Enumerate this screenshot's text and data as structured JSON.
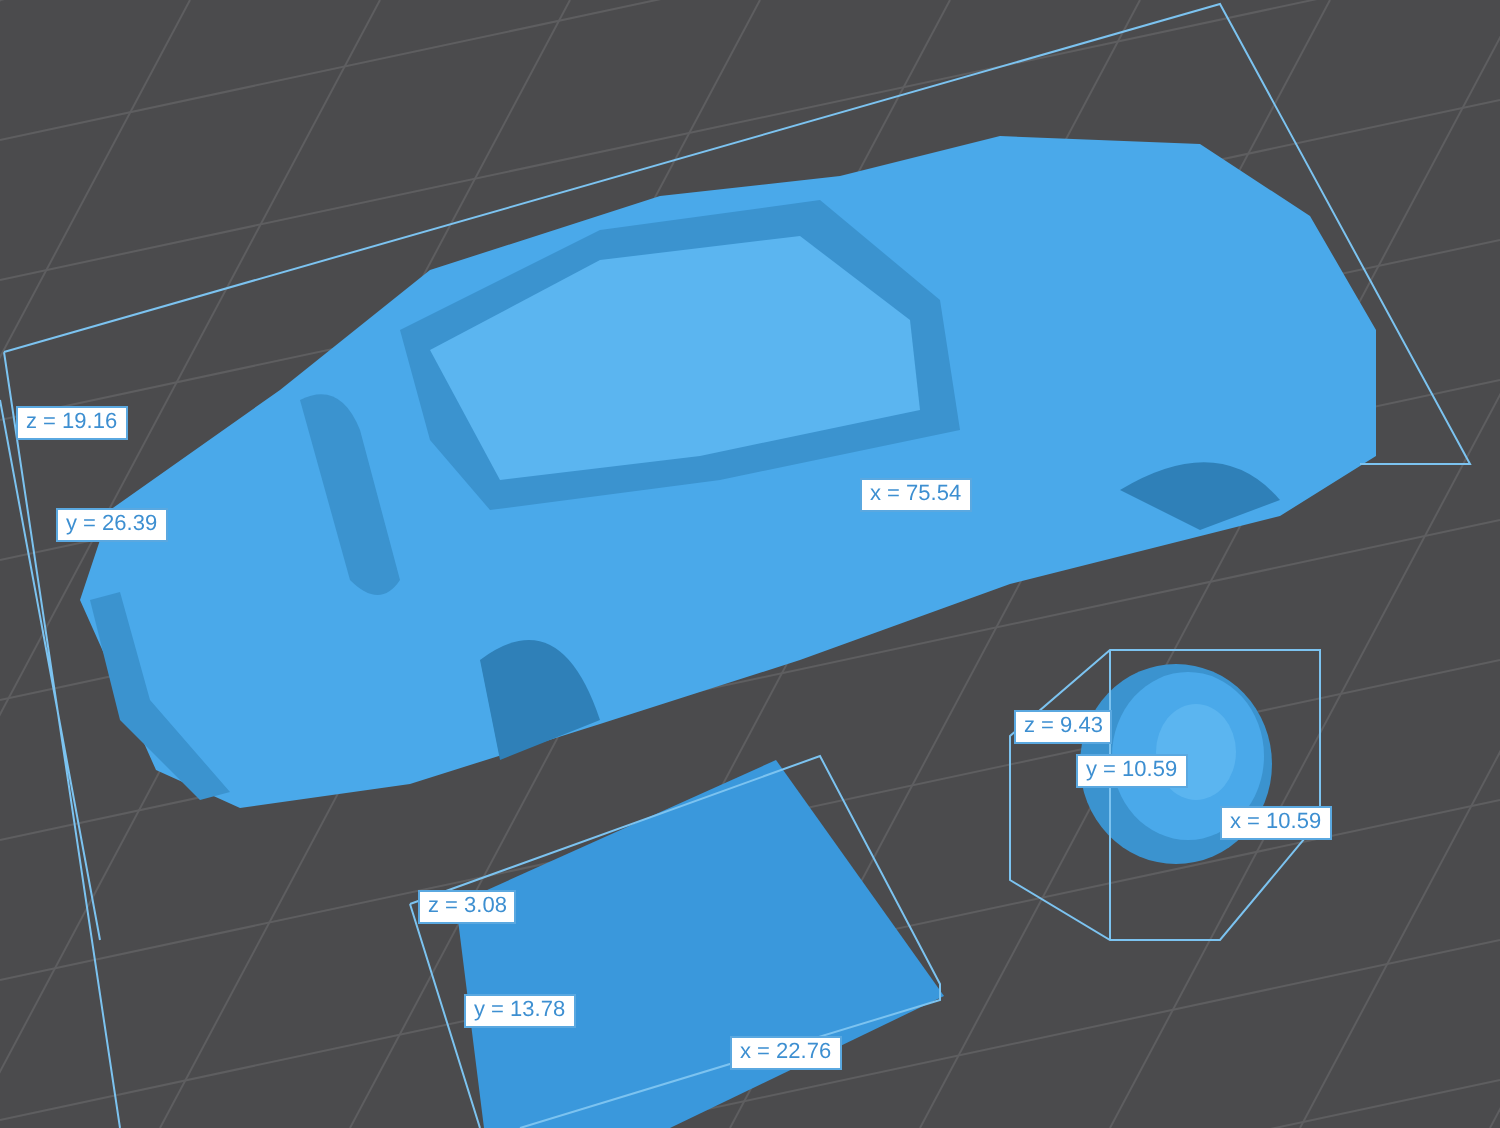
{
  "viewport": {
    "objects": [
      {
        "kind": "car",
        "labels": [
          "z = 19.16",
          "y = 26.39",
          "x = 75.54"
        ]
      },
      {
        "kind": "tire",
        "labels": [
          "z = 9.43",
          "y = 10.59",
          "x = 10.59"
        ]
      },
      {
        "kind": "plate",
        "labels": [
          "z = 3.08",
          "y = 13.78",
          "x = 22.76"
        ]
      }
    ]
  }
}
